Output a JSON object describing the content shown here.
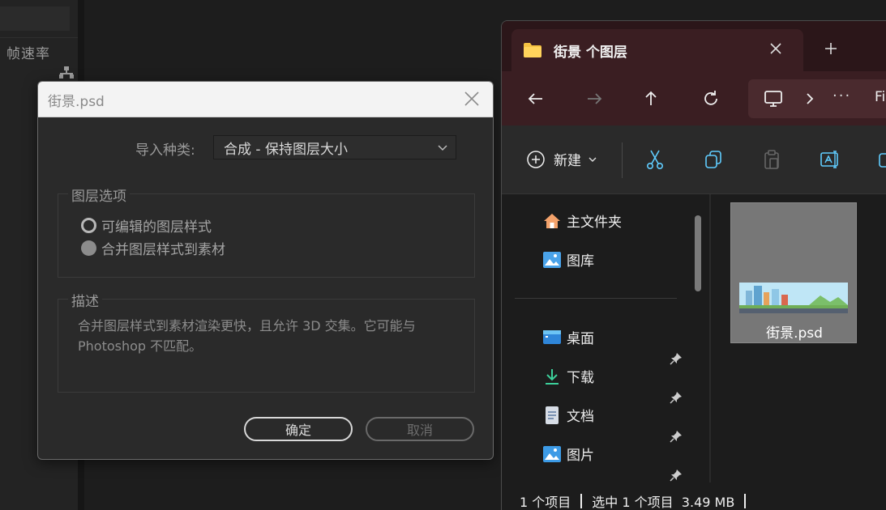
{
  "background": {
    "frame_rate_label": "帧速率"
  },
  "dialog": {
    "title": "街景.psd",
    "import_kind_label": "导入种类:",
    "import_kind_value": "合成 - 保持图层大小",
    "layer_options": {
      "title": "图层选项",
      "option_editable": "可编辑的图层样式",
      "option_merge": "合并图层样式到素材",
      "selected": "option_merge"
    },
    "description": {
      "title": "描述",
      "text": "合并图层样式到素材渲染更快，且允许 3D 交集。它可能与 Photoshop 不匹配。"
    },
    "ok_label": "确定",
    "cancel_label": "取消"
  },
  "explorer": {
    "tab_title": "街景 个图层",
    "address_trail": "Fi",
    "address_more": "···",
    "new_label": "新建",
    "nav_items": [
      {
        "label": "主文件夹",
        "icon": "home-icon",
        "pinned": false
      },
      {
        "label": "图库",
        "icon": "gallery-icon",
        "pinned": false
      },
      {
        "label": "桌面",
        "icon": "desktop-icon",
        "pinned": true
      },
      {
        "label": "下载",
        "icon": "download-icon",
        "pinned": true
      },
      {
        "label": "文档",
        "icon": "document-icon",
        "pinned": true
      },
      {
        "label": "图片",
        "icon": "pictures-icon",
        "pinned": true
      }
    ],
    "file": {
      "name": "街景.psd"
    },
    "status": {
      "item_count": "1 个项目",
      "selection": "选中 1 个项目  3.49 MB"
    },
    "colors": {
      "tab_bg": "#3a1e22",
      "strip_bg": "#2b1619",
      "accent": "#60cdff"
    }
  }
}
